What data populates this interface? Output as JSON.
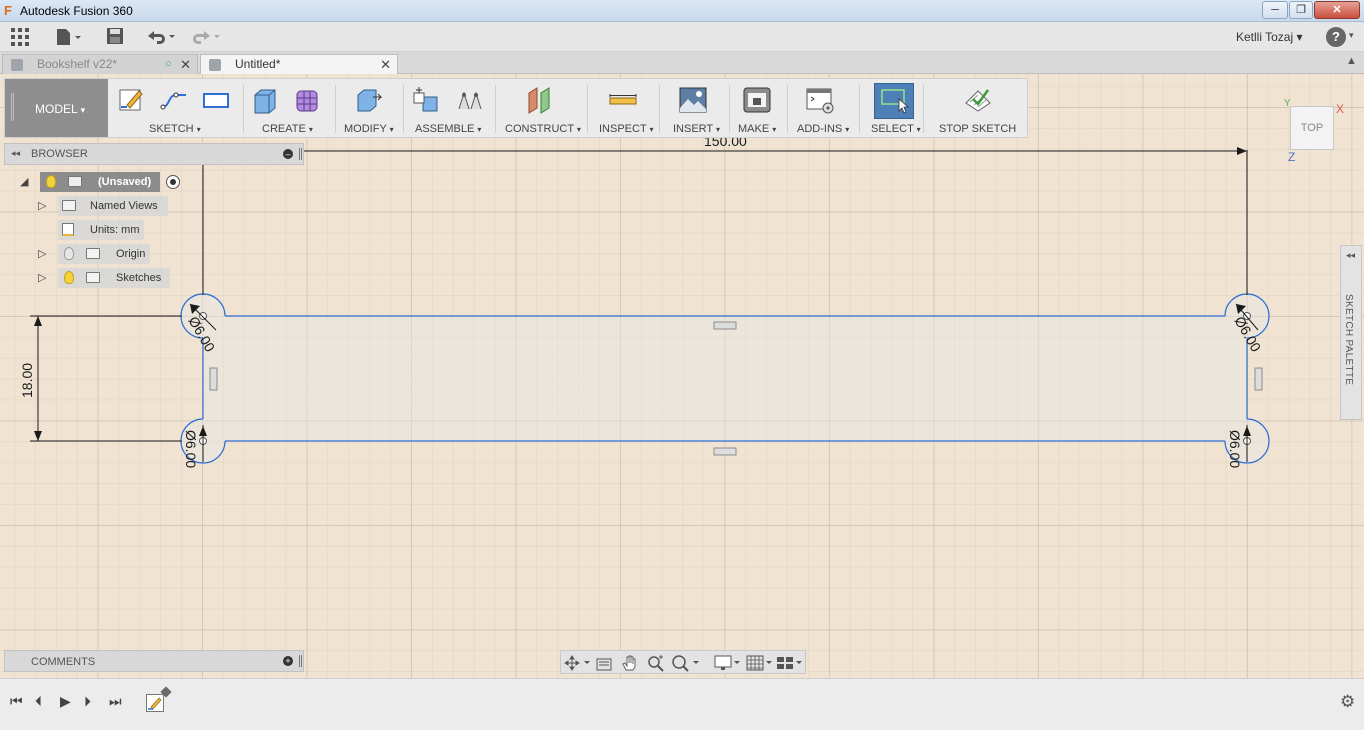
{
  "app": {
    "title": "Autodesk Fusion 360",
    "logo_letter": "F",
    "window_controls": {
      "minimize": "─",
      "maximize": "❐",
      "close": "✕"
    }
  },
  "quick_access": {
    "grid_icon": "apps-grid-icon",
    "user_name": "Ketlli Tozaj",
    "help": "?",
    "caret": "▾"
  },
  "tabs": [
    {
      "label": "Bookshelf v22*",
      "active": false,
      "sync_glyph": "○",
      "close_glyph": "✕"
    },
    {
      "label": "Untitled*",
      "active": true,
      "close_glyph": "✕"
    }
  ],
  "toolbar": {
    "workspace": "MODEL",
    "workspace_caret": "▾",
    "groups": [
      {
        "label": "SKETCH",
        "caret": "▾"
      },
      {
        "label": "CREATE",
        "caret": "▾"
      },
      {
        "label": "MODIFY",
        "caret": "▾"
      },
      {
        "label": "ASSEMBLE",
        "caret": "▾"
      },
      {
        "label": "CONSTRUCT",
        "caret": "▾"
      },
      {
        "label": "INSPECT",
        "caret": "▾"
      },
      {
        "label": "INSERT",
        "caret": "▾"
      },
      {
        "label": "MAKE",
        "caret": "▾"
      },
      {
        "label": "ADD-INS",
        "caret": "▾"
      },
      {
        "label": "SELECT",
        "caret": "▾"
      },
      {
        "label": "STOP SKETCH",
        "caret": ""
      }
    ]
  },
  "viewcube": {
    "face": "TOP",
    "axis_x": "X",
    "axis_y": "Y",
    "axis_z": "Z"
  },
  "browser": {
    "title": "BROWSER",
    "collapse_glyph": "◂◂",
    "minus_glyph": "–",
    "root": "(Unsaved)",
    "nodes": [
      {
        "label": "Named Views"
      },
      {
        "label": "Units: mm"
      },
      {
        "label": "Origin"
      },
      {
        "label": "Sketches"
      }
    ]
  },
  "sketch": {
    "dim_width": "150.00",
    "dim_height": "18.00",
    "dim_diameter": "Ø6.00",
    "line_color": "#2f6fd6",
    "dim_color": "#1a1a1a"
  },
  "sketch_palette": {
    "label": "SKETCH PALETTE",
    "collapse_glyph": "◂◂"
  },
  "comments": {
    "title": "COMMENTS",
    "plus_glyph": "+"
  },
  "navbar": {
    "icons": [
      "orbit-icon",
      "look-at-icon",
      "pan-icon",
      "zoom-icon",
      "fit-icon",
      "display-settings-icon",
      "grid-settings-icon",
      "viewports-icon"
    ]
  },
  "timeline": {
    "first": "⏮",
    "prev": "⏴",
    "play": "▶",
    "next": "⏵",
    "last": "⏭",
    "settings": "⚙"
  }
}
